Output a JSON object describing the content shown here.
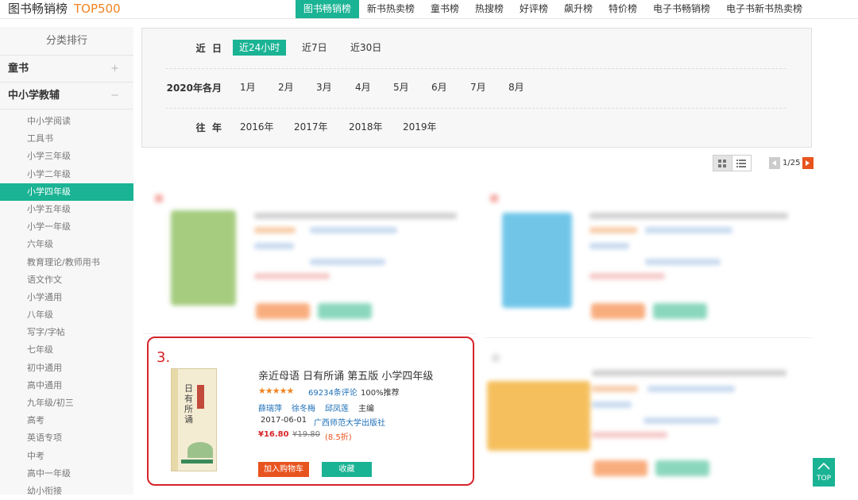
{
  "header": {
    "brand": "图书畅销榜",
    "brand_accent": "TOP500",
    "nav": [
      "图书畅销榜",
      "新书热卖榜",
      "童书榜",
      "热搜榜",
      "好评榜",
      "飙升榜",
      "特价榜",
      "电子书畅销榜",
      "电子书新书热卖榜"
    ],
    "active_nav": "图书畅销榜"
  },
  "sidebar": {
    "title": "分类排行",
    "categories": [
      {
        "label": "童书",
        "toggle": "+"
      },
      {
        "label": "中小学教辅",
        "toggle": "−"
      }
    ],
    "subcategories": [
      "中小学阅读",
      "工具书",
      "小学三年级",
      "小学二年级",
      "小学四年级",
      "小学五年级",
      "小学一年级",
      "六年级",
      "教育理论/教师用书",
      "语文作文",
      "小学通用",
      "八年级",
      "写字/字帖",
      "七年级",
      "初中通用",
      "高中通用",
      "九年级/初三",
      "高考",
      "英语专项",
      "中考",
      "高中一年级",
      "幼小衔接"
    ],
    "active_sub": "小学四年级"
  },
  "filters": {
    "recent": {
      "label": "近  日",
      "options": [
        "近24小时",
        "近7日",
        "近30日"
      ],
      "active": "近24小时"
    },
    "months": {
      "label": "2020年各月",
      "options": [
        "1月",
        "2月",
        "3月",
        "4月",
        "5月",
        "6月",
        "7月",
        "8月"
      ]
    },
    "years": {
      "label": "往  年",
      "options": [
        "2016年",
        "2017年",
        "2018年",
        "2019年"
      ]
    }
  },
  "view": {
    "grid_icon": "grid-view-icon",
    "list_icon": "list-view-icon",
    "active": "grid"
  },
  "pager": {
    "text": "1/25"
  },
  "featured": {
    "rank": "3.",
    "title": "亲近母语 日有所诵 第五版 小学四年级",
    "cover_title": "日有所诵",
    "stars": "★★★★★",
    "rating_stars": 5,
    "reviews": "69234条评论",
    "recommend": "100%推荐",
    "authors": [
      "薛瑞萍",
      "徐冬梅",
      "邱凤莲"
    ],
    "author_role": "主编",
    "pub_date": "2017-06-01",
    "publisher": "广西师范大学出版社",
    "price": "¥16.80",
    "old_price": "¥19.80",
    "discount": "(8.5折)",
    "add_cart": "加入购物车",
    "favorite": "收藏"
  },
  "to_top": "TOP",
  "colors": {
    "accent": "#1ab394",
    "orange": "#e8541e",
    "highlight": "#d6242a",
    "link": "#1d6fb8"
  }
}
